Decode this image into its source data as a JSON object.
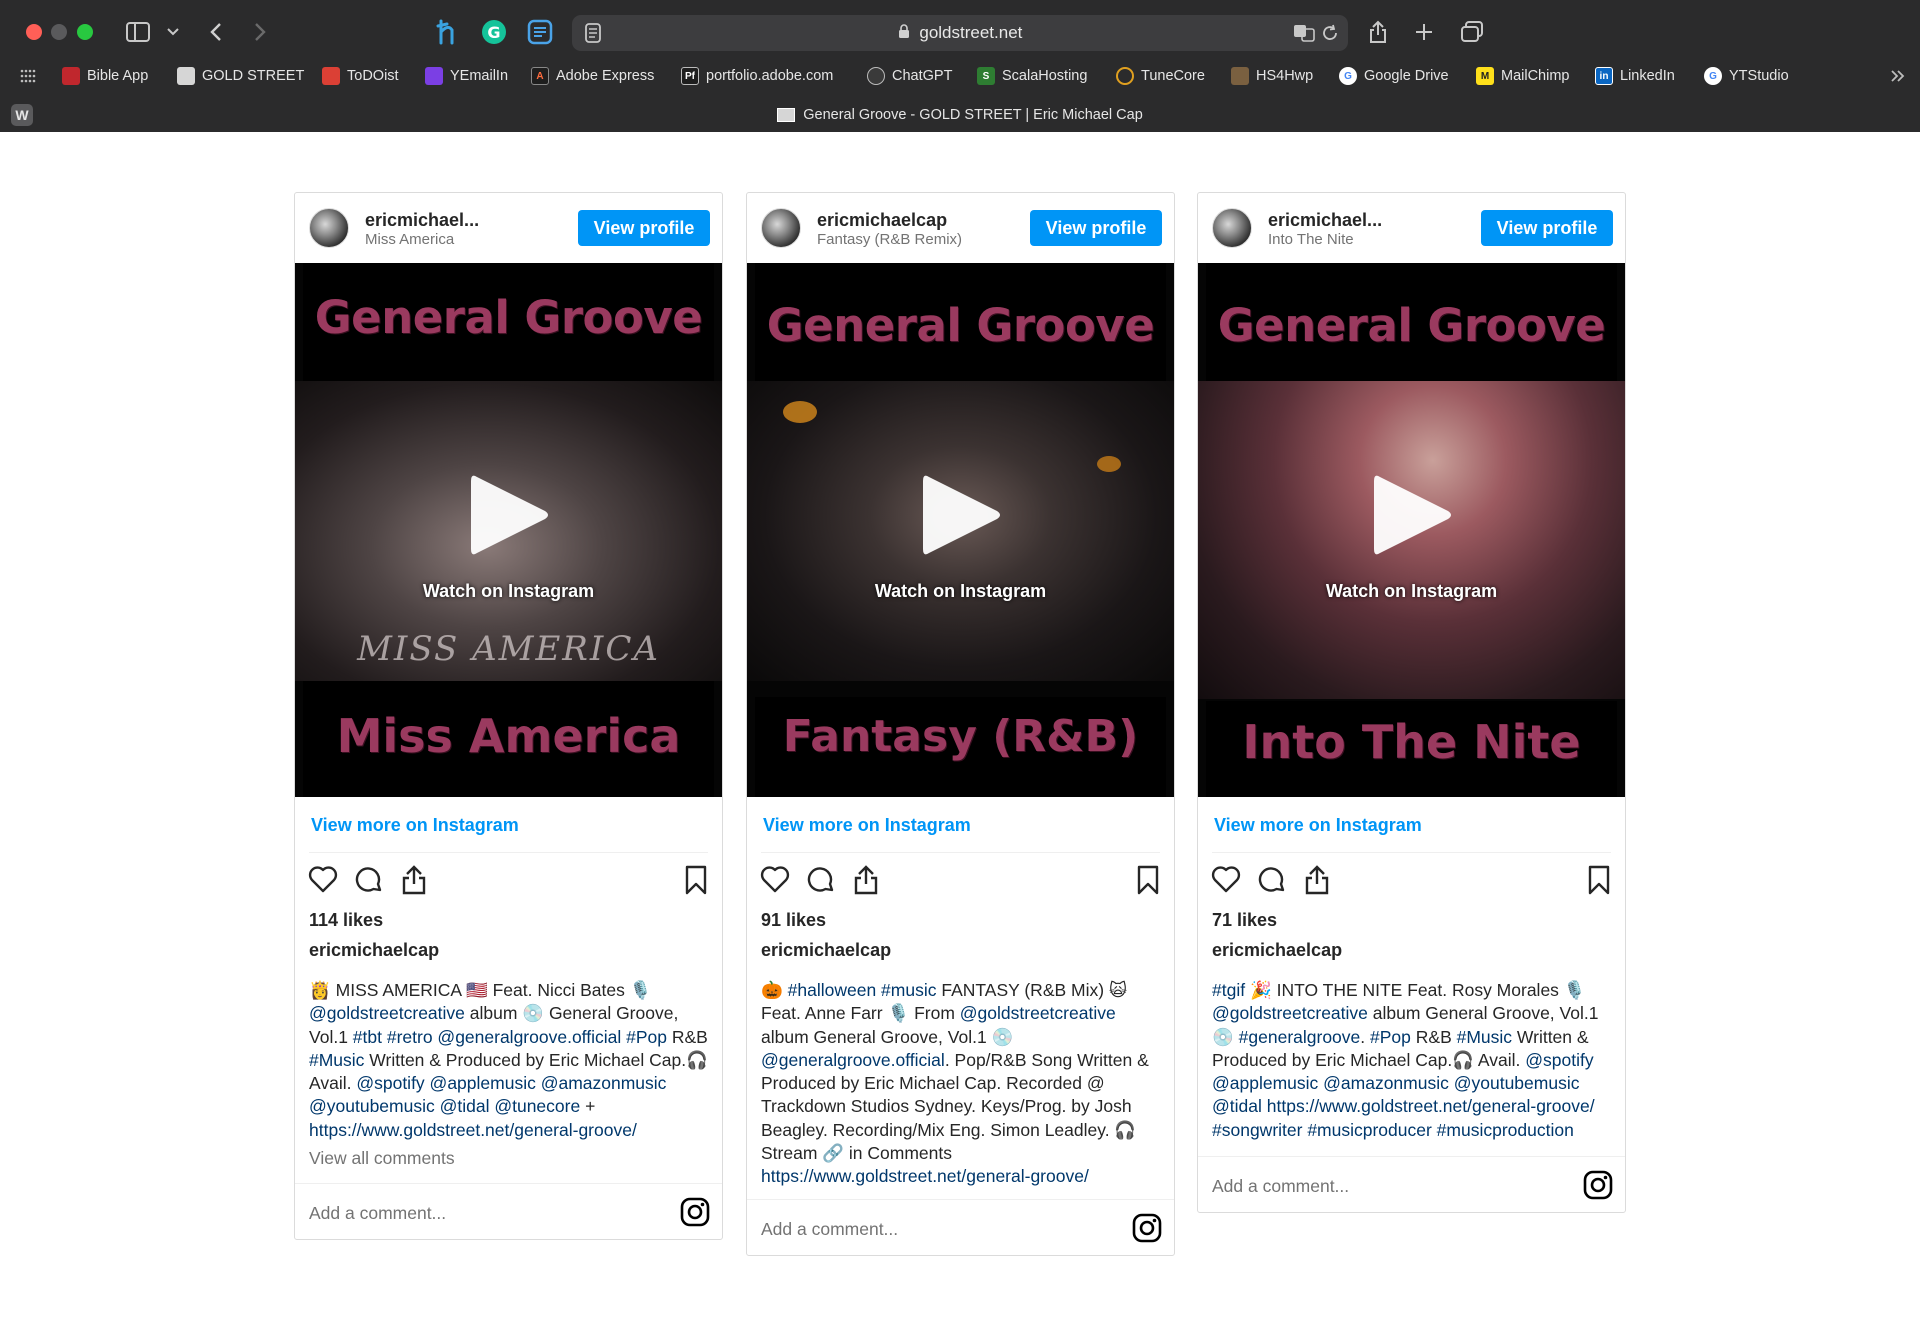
{
  "browser": {
    "url": "goldstreet.net",
    "tab_title": "General Groove - GOLD STREET | Eric Michael Cap",
    "bookmarks": [
      {
        "label": "Bible App",
        "color": "#c0272d"
      },
      {
        "label": "GOLD STREET",
        "color": "#cccccc"
      },
      {
        "label": "ToDOist",
        "color": "#db4035"
      },
      {
        "label": "YEmailIn",
        "color": "#7b3fe4"
      },
      {
        "label": "Adobe Express",
        "color": "#1e1e1e"
      },
      {
        "label": "portfolio.adobe.com",
        "color": "#1e1e1e"
      },
      {
        "label": "ChatGPT",
        "color": "#3a3a3a"
      },
      {
        "label": "ScalaHosting",
        "color": "#3a3a3a"
      },
      {
        "label": "TuneCore",
        "color": "#3a3a3a"
      },
      {
        "label": "HS4Hwp",
        "color": "#7a6040"
      },
      {
        "label": "Google Drive",
        "color": "#ffffff"
      },
      {
        "label": "MailChimp",
        "color": "#ffe01b"
      },
      {
        "label": "LinkedIn",
        "color": "#0a66c2"
      },
      {
        "label": "YTStudio",
        "color": "#ffffff"
      }
    ]
  },
  "posts": [
    {
      "username": "ericmichael...",
      "subtitle": "Miss America",
      "view_profile": "View profile",
      "media_title": "General Groove",
      "song_title": "Miss America",
      "overlay_text": "MISS AMERICA",
      "watch": "Watch on Instagram",
      "view_more": "View more on Instagram",
      "likes": "114 likes",
      "author": "ericmichaelcap",
      "caption": [
        {
          "t": "👸 MISS AMERICA 🇺🇸 Feat. Nicci Bates 🎙️ "
        },
        {
          "t": "@goldstreetcreative",
          "link": true
        },
        {
          "t": " album 💿 General Groove, Vol.1 "
        },
        {
          "t": "#tbt #retro @generalgroove.official #Pop",
          "link": true
        },
        {
          "t": " R&B "
        },
        {
          "t": "#Music",
          "link": true
        },
        {
          "t": " Written & Produced by Eric Michael Cap.🎧 Avail. "
        },
        {
          "t": "@spotify @applemusic @amazonmusic @youtubemusic @tidal @tunecore",
          "link": true
        },
        {
          "t": " + "
        },
        {
          "t": "https://www.goldstreet.net/general-groove/",
          "link": true
        }
      ],
      "view_all": "View all comments",
      "comment_placeholder": "Add a comment..."
    },
    {
      "username": "ericmichaelcap",
      "subtitle": "Fantasy (R&B Remix)",
      "view_profile": "View profile",
      "media_title": "General Groove",
      "song_title": "Fantasy (R&B)",
      "overlay_text": "",
      "watch": "Watch on Instagram",
      "view_more": "View more on Instagram",
      "likes": "91 likes",
      "author": "ericmichaelcap",
      "caption": [
        {
          "t": "🎃 "
        },
        {
          "t": "#halloween #music",
          "link": true
        },
        {
          "t": " FANTASY (R&B Mix) 🙀 Feat. Anne Farr 🎙️ From "
        },
        {
          "t": "@goldstreetcreative",
          "link": true
        },
        {
          "t": " album General Groove, Vol.1 💿 "
        },
        {
          "t": "@generalgroove.official",
          "link": true
        },
        {
          "t": ". Pop/R&B Song Written & Produced by Eric Michael Cap. Recorded @ Trackdown Studios Sydney. Keys/Prog. by Josh Beagley. Recording/Mix Eng. Simon Leadley. 🎧 Stream 🔗 in Comments "
        },
        {
          "t": "https://www.goldstreet.net/general-groove/",
          "link": true
        }
      ],
      "view_all": "",
      "comment_placeholder": "Add a comment..."
    },
    {
      "username": "ericmichael...",
      "subtitle": "Into The Nite",
      "view_profile": "View profile",
      "media_title": "General Groove",
      "song_title": "Into The Nite",
      "overlay_text": "",
      "watch": "Watch on Instagram",
      "view_more": "View more on Instagram",
      "likes": "71 likes",
      "author": "ericmichaelcap",
      "caption": [
        {
          "t": "#tgif",
          "link": true
        },
        {
          "t": " 🎉 INTO THE NITE Feat. Rosy Morales 🎙️ "
        },
        {
          "t": "@goldstreetcreative",
          "link": true
        },
        {
          "t": " album General Groove, Vol.1 💿 "
        },
        {
          "t": "#generalgroove",
          "link": true
        },
        {
          "t": ". "
        },
        {
          "t": "#Pop",
          "link": true
        },
        {
          "t": " R&B "
        },
        {
          "t": "#Music",
          "link": true
        },
        {
          "t": " Written & Produced by Eric Michael Cap.🎧 Avail. "
        },
        {
          "t": "@spotify @applemusic @amazonmusic @youtubemusic @tidal",
          "link": true
        },
        {
          "t": " "
        },
        {
          "t": "https://www.goldstreet.net/general-groove/ #songwriter #musicproducer #musicproduction",
          "link": true
        }
      ],
      "view_all": "",
      "comment_placeholder": "Add a comment..."
    }
  ],
  "colors": {
    "instagram_blue": "#0095f6",
    "link_navy": "#00376b",
    "title_magenta": "#9a3a5f"
  }
}
